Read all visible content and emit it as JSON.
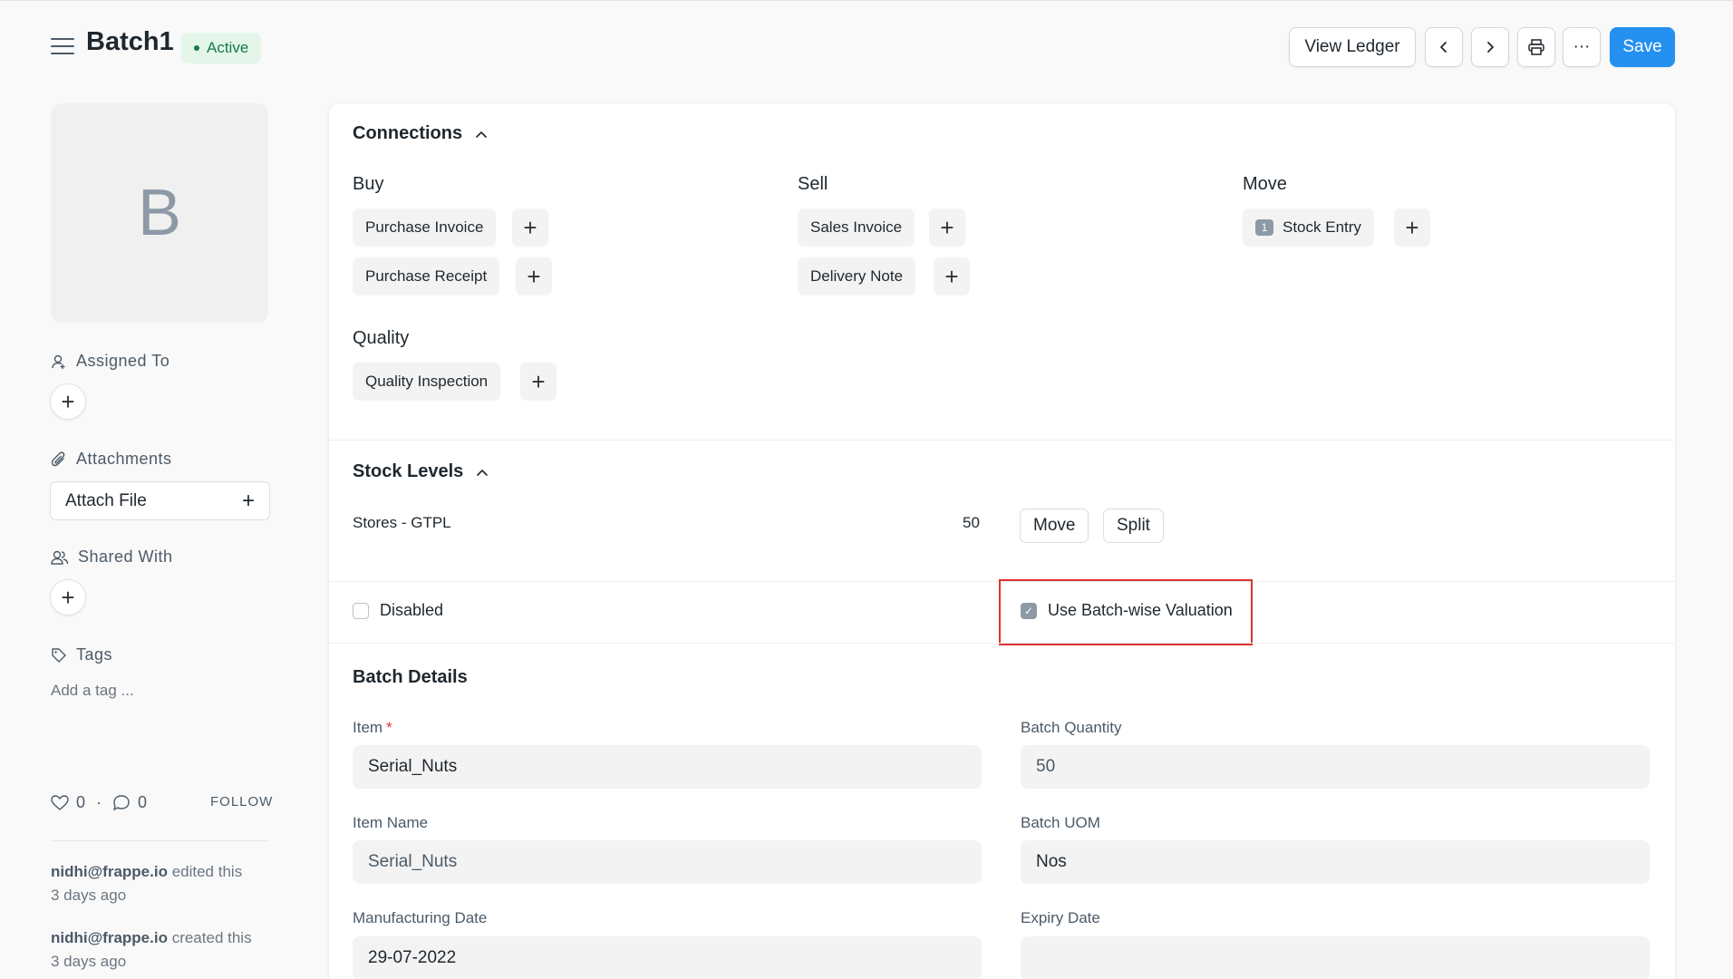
{
  "header": {
    "title": "Batch1",
    "status": "Active",
    "view_ledger": "View Ledger",
    "more": "···",
    "save": "Save"
  },
  "sidebar": {
    "avatar_letter": "B",
    "assigned_to": "Assigned To",
    "attachments": "Attachments",
    "attach_file": "Attach File",
    "shared_with": "Shared With",
    "tags": "Tags",
    "add_tag": "Add a tag ...",
    "likes": "0",
    "comments": "0",
    "follow": "FOLLOW",
    "activity": [
      {
        "user": "nidhi@frappe.io",
        "action": " edited this",
        "time": "3 days ago"
      },
      {
        "user": "nidhi@frappe.io",
        "action": " created this",
        "time": "3 days ago"
      }
    ]
  },
  "connections": {
    "title": "Connections",
    "buy": {
      "label": "Buy",
      "items": [
        "Purchase Invoice",
        "Purchase Receipt"
      ]
    },
    "sell": {
      "label": "Sell",
      "items": [
        "Sales Invoice",
        "Delivery Note"
      ]
    },
    "move": {
      "label": "Move",
      "items": [
        {
          "label": "Stock Entry",
          "count": "1"
        }
      ]
    },
    "quality": {
      "label": "Quality",
      "items": [
        "Quality Inspection"
      ]
    }
  },
  "stock_levels": {
    "title": "Stock Levels",
    "warehouse": "Stores - GTPL",
    "qty": "50",
    "move_btn": "Move",
    "split_btn": "Split"
  },
  "flags": {
    "disabled_label": "Disabled",
    "disabled_checked": false,
    "batch_valuation_label": "Use Batch-wise Valuation",
    "batch_valuation_checked": true
  },
  "batch_details": {
    "title": "Batch Details",
    "item_label": "Item",
    "item_required": "*",
    "item_value": "Serial_Nuts",
    "batch_qty_label": "Batch Quantity",
    "batch_qty_value": "50",
    "item_name_label": "Item Name",
    "item_name_value": "Serial_Nuts",
    "batch_uom_label": "Batch UOM",
    "batch_uom_value": "Nos",
    "mfg_date_label": "Manufacturing Date",
    "mfg_date_value": "29-07-2022",
    "expiry_date_label": "Expiry Date",
    "expiry_date_value": ""
  },
  "colors": {
    "primary": "#2490ef",
    "active_bg": "#e4f5e9",
    "active_text": "#16794c",
    "highlight": "#e03131"
  }
}
